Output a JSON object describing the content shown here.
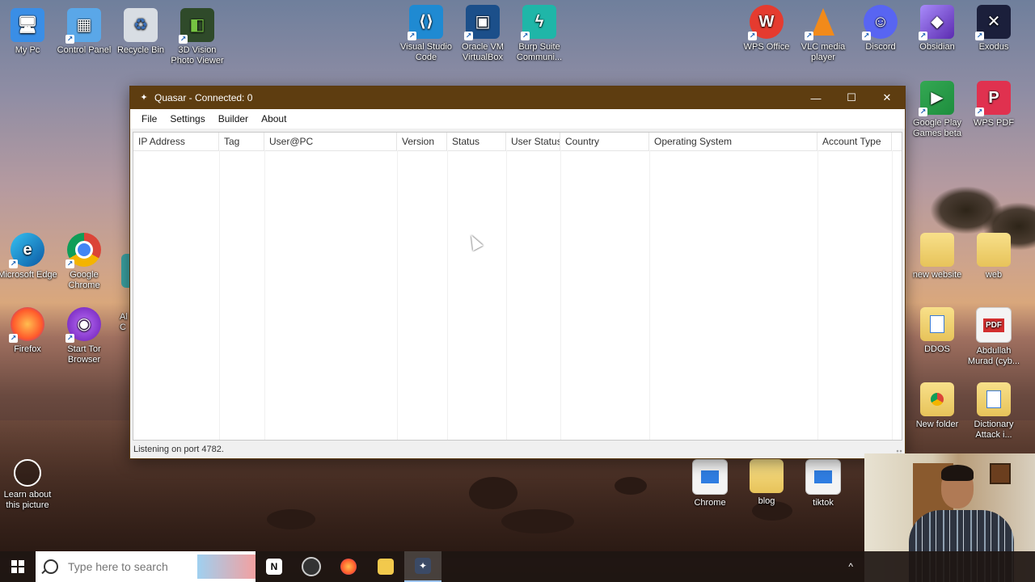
{
  "desktop": {
    "icons_left": [
      {
        "label": "My Pc",
        "icon": "computer-icon"
      },
      {
        "label": "Control Panel",
        "icon": "control-panel-icon"
      },
      {
        "label": "Recycle Bin",
        "icon": "recycle-bin-icon"
      },
      {
        "label": "3D Vision Photo Viewer",
        "icon": "3d-vision-icon"
      },
      {
        "label": "Microsoft Edge",
        "icon": "edge-icon"
      },
      {
        "label": "Google Chrome",
        "icon": "chrome-icon"
      },
      {
        "label": "Firefox",
        "icon": "firefox-icon"
      },
      {
        "label": "Start Tor Browser",
        "icon": "tor-icon"
      },
      {
        "label": "Learn about this picture",
        "icon": "camera-icon"
      }
    ],
    "icons_top": [
      {
        "label": "Visual Studio Code",
        "icon": "vscode-icon"
      },
      {
        "label": "Oracle VM VirtualBox",
        "icon": "virtualbox-icon"
      },
      {
        "label": "Burp Suite Communi...",
        "icon": "burp-icon"
      },
      {
        "label": "WPS Office",
        "icon": "wps-icon"
      },
      {
        "label": "VLC media player",
        "icon": "vlc-icon"
      },
      {
        "label": "Discord",
        "icon": "discord-icon"
      },
      {
        "label": "Obsidian",
        "icon": "obsidian-icon"
      },
      {
        "label": "Exodus",
        "icon": "exodus-icon"
      }
    ],
    "icons_right": [
      {
        "label": "Google Play Games beta",
        "icon": "play-games-icon"
      },
      {
        "label": "WPS PDF",
        "icon": "wps-pdf-icon"
      },
      {
        "label": "new website",
        "icon": "folder-icon"
      },
      {
        "label": "web",
        "icon": "folder-icon"
      },
      {
        "label": "DDOS",
        "icon": "document-icon"
      },
      {
        "label": "Abdullah Murad (cyb...",
        "icon": "pdf-icon"
      },
      {
        "label": "New folder",
        "icon": "folder-icon"
      },
      {
        "label": "Dictionary Attack i...",
        "icon": "document-icon"
      }
    ],
    "icons_bottom": [
      {
        "label": "Chrome",
        "icon": "shortcut-icon"
      },
      {
        "label": "blog",
        "icon": "folder-icon"
      },
      {
        "label": "tiktok",
        "icon": "shortcut-icon"
      }
    ],
    "partial_label": "Al\nC"
  },
  "window": {
    "title": "Quasar - Connected: 0",
    "controls": {
      "minimize": "—",
      "maximize": "☐",
      "close": "✕"
    },
    "menu": [
      "File",
      "Settings",
      "Builder",
      "About"
    ],
    "columns": [
      "IP Address",
      "Tag",
      "User@PC",
      "Version",
      "Status",
      "User Status",
      "Country",
      "Operating System",
      "Account Type"
    ],
    "rows": [],
    "status": "Listening on port 4782."
  },
  "taskbar": {
    "search_placeholder": "Type here to search",
    "apps": [
      "notion-icon",
      "chrome-devtools-icon",
      "firefox-icon",
      "file-explorer-icon",
      "quasar-icon"
    ],
    "tray_chevron": "^"
  },
  "colors": {
    "titlebar": "#5e3d10",
    "window_bg": "#f0f0f0"
  }
}
